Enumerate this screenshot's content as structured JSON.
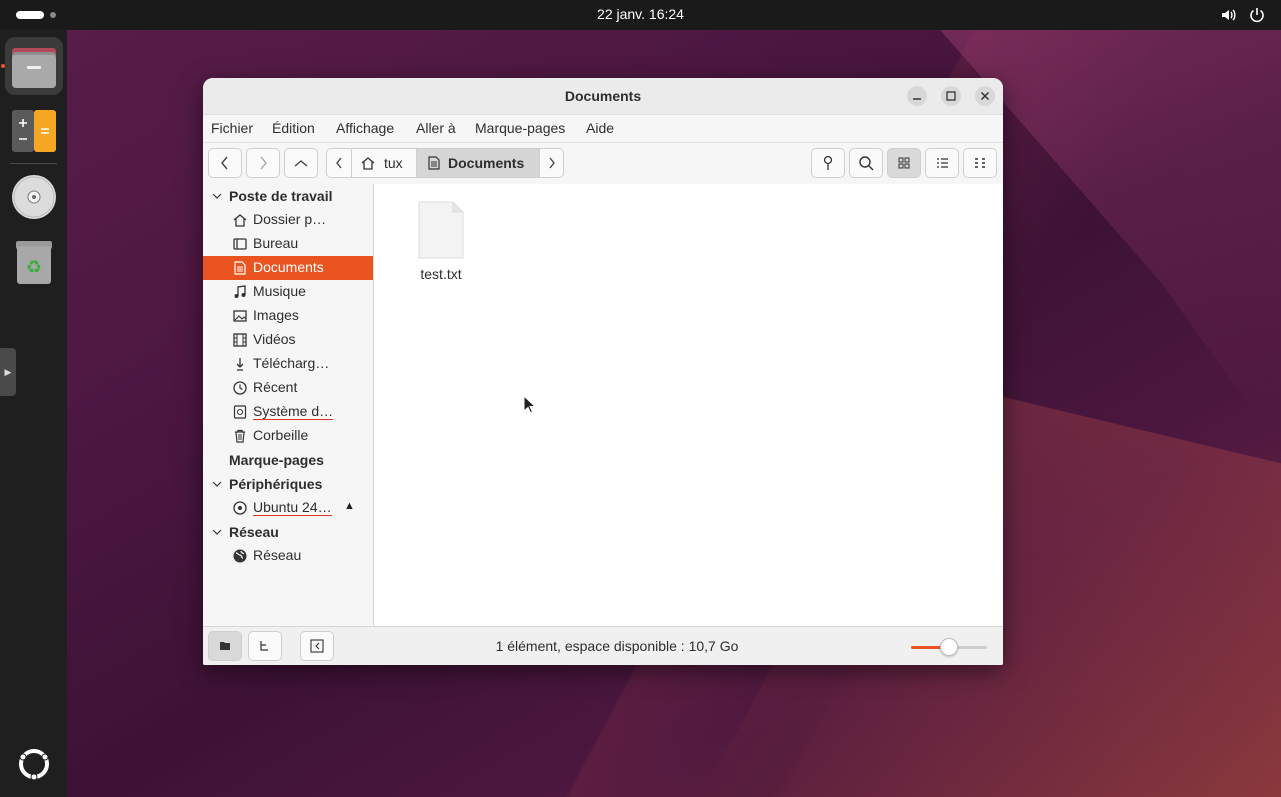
{
  "topbar": {
    "clock": "22 janv.  16:24",
    "icons": [
      "volume-icon",
      "power-icon"
    ]
  },
  "dock": {
    "items": [
      "files-app",
      "calculator-app",
      "optical-disc",
      "trash"
    ],
    "accent_color": "#e95420"
  },
  "window": {
    "title": "Documents",
    "controls": [
      "minimize",
      "maximize",
      "close"
    ]
  },
  "menubar": {
    "items": [
      "Fichier",
      "Édition",
      "Affichage",
      "Aller à",
      "Marque-pages",
      "Aide"
    ]
  },
  "pathbar": {
    "home_label": "tux",
    "current_label": "Documents"
  },
  "sidebar": {
    "sections": {
      "workstation": "Poste de travail",
      "bookmarks": "Marque-pages",
      "devices": "Périphériques",
      "network": "Réseau"
    },
    "items": [
      {
        "label": "Dossier p…",
        "icon": "home-icon"
      },
      {
        "label": "Bureau",
        "icon": "desktop-icon"
      },
      {
        "label": "Documents",
        "icon": "document-icon",
        "selected": true
      },
      {
        "label": "Musique",
        "icon": "music-icon"
      },
      {
        "label": "Images",
        "icon": "image-icon"
      },
      {
        "label": "Vidéos",
        "icon": "film-icon"
      },
      {
        "label": "Télécharg…",
        "icon": "download-icon"
      },
      {
        "label": "Récent",
        "icon": "clock-icon"
      },
      {
        "label": "Système d…",
        "icon": "drive-icon"
      },
      {
        "label": "Corbeille",
        "icon": "trash-icon"
      }
    ],
    "devices": [
      {
        "label": "Ubuntu 24…",
        "icon": "disc-icon",
        "eject": "▲"
      }
    ],
    "network_items": [
      {
        "label": "Réseau",
        "icon": "globe-icon"
      }
    ],
    "selected_color": "#e95420"
  },
  "content": {
    "files": [
      {
        "name": "test.txt",
        "icon": "text-file-icon"
      }
    ]
  },
  "statusbar": {
    "text": "1 élément, espace disponible : 10,7 Go",
    "zoom_level": 0.5
  }
}
